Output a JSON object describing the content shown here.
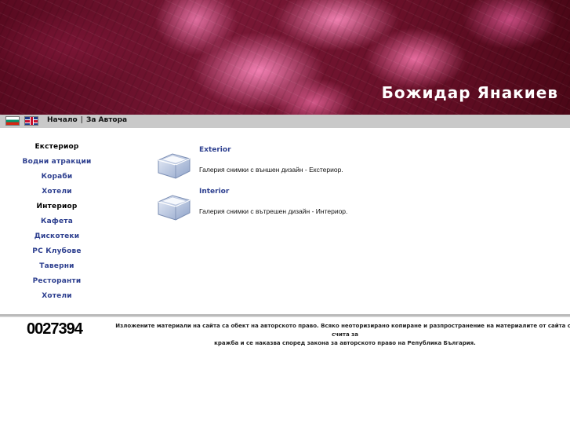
{
  "header": {
    "site_title": "Божидар Янакиев"
  },
  "navbar": {
    "flags": [
      {
        "icon": "bulgarian-flag-icon"
      },
      {
        "icon": "uk-flag-icon"
      }
    ],
    "links": [
      {
        "label": "Начало"
      },
      {
        "label": "За Автора"
      }
    ],
    "separator": "|"
  },
  "sidebar": {
    "items": [
      {
        "label": "Екстериор",
        "heading": true
      },
      {
        "label": "Водни атракции"
      },
      {
        "label": "Кораби"
      },
      {
        "label": "Хотели"
      },
      {
        "label": "Интериор",
        "heading": true
      },
      {
        "label": "Кафета"
      },
      {
        "label": "Дискотеки"
      },
      {
        "label": "PC Клубове"
      },
      {
        "label": "Таверни"
      },
      {
        "label": "Ресторанти"
      },
      {
        "label": "Хотели"
      }
    ]
  },
  "gallery": {
    "entries": [
      {
        "title": "Exterior",
        "description": "Галерия снимки с външен дизайн - Екстериор.",
        "icon": "folder-icon"
      },
      {
        "title": "Interior",
        "description": "Галерия снимки с вътрешен дизайн - Интериор.",
        "icon": "folder-icon"
      }
    ]
  },
  "footer": {
    "counter": "0027394",
    "copyright_line1": "Изложените материали на сайта са обект на авторското право. Всяко неоторизирано копиране и разпространение на материалите от сайта се счита за",
    "copyright_line2": "кражба и се наказва според закона за авторското право на Република България."
  }
}
